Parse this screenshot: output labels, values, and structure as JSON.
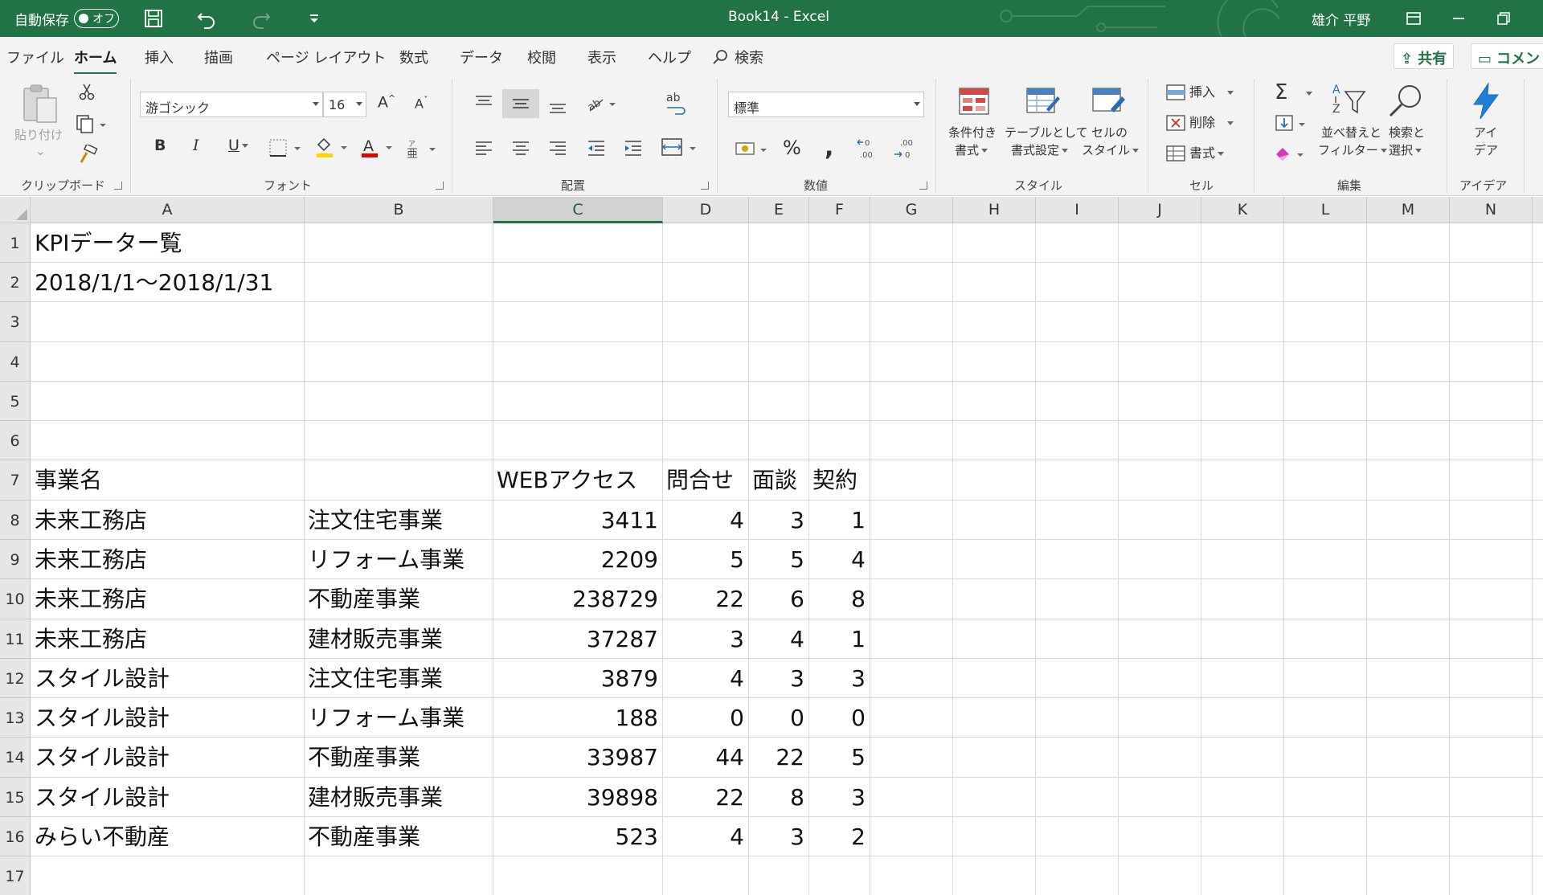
{
  "titlebar": {
    "autosave_label": "自動保存",
    "autosave_state": "オフ",
    "doc_title": "Book14  -  Excel",
    "user_name": "雄介 平野"
  },
  "tabs": [
    "ファイル",
    "ホーム",
    "挿入",
    "描画",
    "ページ レイアウト",
    "数式",
    "データ",
    "校閲",
    "表示",
    "ヘルプ"
  ],
  "active_tab": "ホーム",
  "search_label": "検索",
  "share_label": "共有",
  "comment_label": "コメント",
  "ribbon": {
    "clipboard": {
      "paste": "貼り付け",
      "label": "クリップボード"
    },
    "font": {
      "name": "游ゴシック",
      "size": "16",
      "label": "フォント"
    },
    "alignment": {
      "label": "配置"
    },
    "number": {
      "format": "標準",
      "label": "数値"
    },
    "styles": {
      "cond1": "条件付き",
      "cond2": "書式",
      "table1": "テーブルとして",
      "table2": "書式設定",
      "cell1": "セルの",
      "cell2": "スタイル",
      "label": "スタイル"
    },
    "cells": {
      "insert": "挿入",
      "delete": "削除",
      "format": "書式",
      "label": "セル"
    },
    "editing": {
      "sort1": "並べ替えと",
      "sort2": "フィルター",
      "find1": "検索と",
      "find2": "選択",
      "label": "編集"
    },
    "ideas": {
      "l1": "アイ",
      "l2": "デア",
      "label": "アイデア"
    }
  },
  "columns": [
    "A",
    "B",
    "C",
    "D",
    "E",
    "F",
    "G",
    "H",
    "I",
    "J",
    "K",
    "L",
    "M",
    "N"
  ],
  "selected_column": "C",
  "rows": [
    "1",
    "2",
    "3",
    "4",
    "5",
    "6",
    "7",
    "8",
    "9",
    "10",
    "11",
    "12",
    "13",
    "14",
    "15",
    "16",
    "17"
  ],
  "sheet": {
    "title": "KPIデーター覧",
    "period": "2018/1/1～2018/1/31",
    "headers": {
      "a": "事業名",
      "c": "WEBアクセス",
      "d": "問合せ",
      "e": "面談",
      "f": "契約"
    },
    "data": [
      {
        "a": "未来工務店",
        "b": "注文住宅事業",
        "c": "3411",
        "d": "4",
        "e": "3",
        "f": "1"
      },
      {
        "a": "未来工務店",
        "b": "リフォーム事業",
        "c": "2209",
        "d": "5",
        "e": "5",
        "f": "4"
      },
      {
        "a": "未来工務店",
        "b": "不動産事業",
        "c": "238729",
        "d": "22",
        "e": "6",
        "f": "8"
      },
      {
        "a": "未来工務店",
        "b": "建材販売事業",
        "c": "37287",
        "d": "3",
        "e": "4",
        "f": "1"
      },
      {
        "a": "スタイル設計",
        "b": "注文住宅事業",
        "c": "3879",
        "d": "4",
        "e": "3",
        "f": "3"
      },
      {
        "a": "スタイル設計",
        "b": "リフォーム事業",
        "c": "188",
        "d": "0",
        "e": "0",
        "f": "0"
      },
      {
        "a": "スタイル設計",
        "b": "不動産事業",
        "c": "33987",
        "d": "44",
        "e": "22",
        "f": "5"
      },
      {
        "a": "スタイル設計",
        "b": "建材販売事業",
        "c": "39898",
        "d": "22",
        "e": "8",
        "f": "3"
      },
      {
        "a": "みらい不動産",
        "b": "不動産事業",
        "c": "523",
        "d": "4",
        "e": "3",
        "f": "2"
      }
    ]
  },
  "colors": {
    "accent": "#217346",
    "ribbon_bg": "#f3f3f3",
    "header_bg": "#e6e6e6"
  }
}
